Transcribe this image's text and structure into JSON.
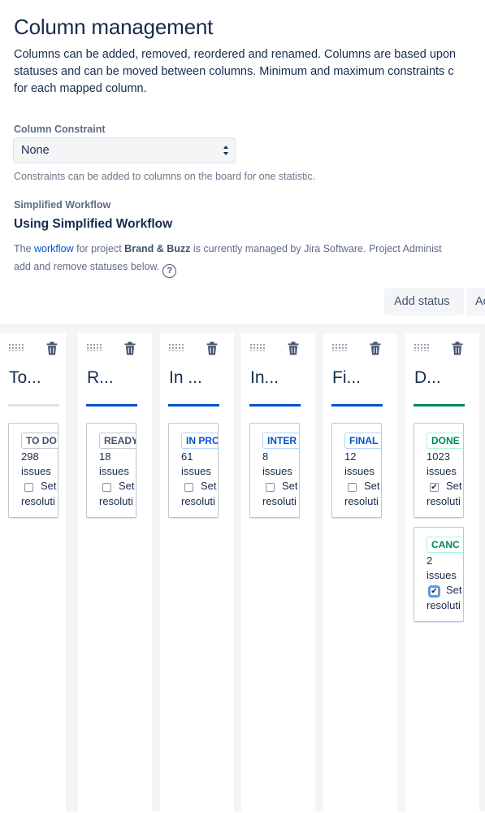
{
  "page": {
    "title": "Column management",
    "description_lines": [
      "Columns can be added, removed, reordered and renamed. Columns are based upon",
      "statuses and can be moved between columns. Minimum and maximum constraints c",
      "for each mapped column."
    ]
  },
  "constraint": {
    "label": "Column Constraint",
    "value": "None",
    "help": "Constraints can be added to columns on the board for one statistic."
  },
  "workflow": {
    "label": "Simplified Workflow",
    "title": "Using Simplified Workflow",
    "para_pre": "The ",
    "link": "workflow",
    "para_mid": " for project ",
    "project": "Brand & Buzz",
    "para_post": " is currently managed by Jira Software. Project Administ",
    "para_line2": "add and remove statuses below.",
    "help_icon": "question-circle-icon"
  },
  "toolbar": {
    "add_status": "Add status",
    "add_column_partial": "Ac"
  },
  "colors": {
    "todo": "#dfe1e6",
    "in_progress": "#0052cc",
    "done": "#00875a"
  },
  "board": {
    "columns": [
      {
        "title": "To...",
        "bar": "todo",
        "statuses": [
          {
            "name": "TO DO",
            "count": "298",
            "unit": "issues",
            "set": "Set",
            "res": "resoluti",
            "checked": false,
            "kind": "todo"
          }
        ]
      },
      {
        "title": "R...",
        "bar": "in_progress",
        "statuses": [
          {
            "name": "READY",
            "count": "18",
            "unit": "issues",
            "set": "Set",
            "res": "resoluti",
            "checked": false,
            "kind": "todo"
          }
        ]
      },
      {
        "title": "In ...",
        "bar": "in_progress",
        "statuses": [
          {
            "name": "IN PRO",
            "count": "61",
            "unit": "issues",
            "set": "Set",
            "res": "resoluti",
            "checked": false,
            "kind": "in_progress"
          }
        ]
      },
      {
        "title": "In...",
        "bar": "in_progress",
        "statuses": [
          {
            "name": "INTER",
            "count": "8",
            "unit": "issues",
            "set": "Set",
            "res": "resoluti",
            "checked": false,
            "kind": "in_progress"
          }
        ]
      },
      {
        "title": "Fi...",
        "bar": "in_progress",
        "statuses": [
          {
            "name": "FINAL",
            "count": "12",
            "unit": "issues",
            "set": "Set",
            "res": "resoluti",
            "checked": false,
            "kind": "in_progress"
          }
        ]
      },
      {
        "title": "D...",
        "bar": "done",
        "statuses": [
          {
            "name": "DONE",
            "count": "1023",
            "unit": "issues",
            "set": "Set",
            "res": "resoluti",
            "checked": true,
            "kind": "done"
          },
          {
            "name": "CANC",
            "count": "2",
            "unit": "issues",
            "set": "Set",
            "res": "resoluti",
            "checked": true,
            "kind": "done"
          }
        ]
      }
    ]
  }
}
